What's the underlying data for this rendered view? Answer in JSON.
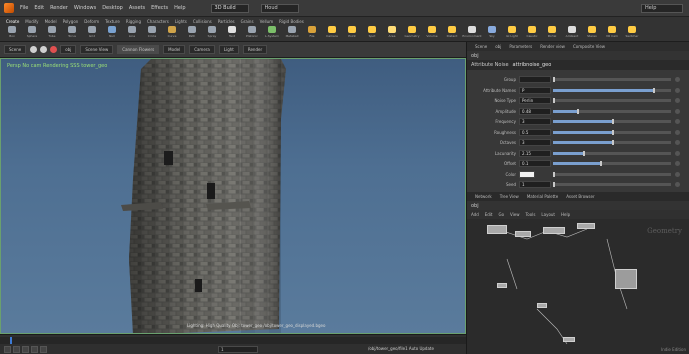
{
  "menubar": {
    "items": [
      "File",
      "Edit",
      "Render",
      "Windows",
      "Desktop",
      "Assets",
      "Effects",
      "Help"
    ],
    "desktop": "3D Build",
    "desktop2": "Houd",
    "help_search": "Help"
  },
  "shelf": {
    "tabs": [
      "Create",
      "Modify",
      "Model",
      "Polygon",
      "Deform",
      "Texture",
      "Rigging",
      "Characters",
      "Lights",
      "Collisions",
      "Particles",
      "Grains",
      "Vellum",
      "Rigid Bodies"
    ],
    "tools": [
      {
        "label": "Box",
        "color": "#9aa4b0"
      },
      {
        "label": "Sphere",
        "color": "#9aa4b0"
      },
      {
        "label": "Tube",
        "color": "#9aa4b0"
      },
      {
        "label": "Torus",
        "color": "#9aa4b0"
      },
      {
        "label": "Grid",
        "color": "#9aa4b0"
      },
      {
        "label": "Null",
        "color": "#7aa2d0"
      },
      {
        "label": "Line",
        "color": "#9aa4b0"
      },
      {
        "label": "Circle",
        "color": "#9aa4b0"
      },
      {
        "label": "Curve",
        "color": "#d0a44a"
      },
      {
        "label": "Path",
        "color": "#9aa4b0"
      },
      {
        "label": "Spray",
        "color": "#9aa4b0"
      },
      {
        "label": "Text",
        "color": "#e0e0e0"
      },
      {
        "label": "Platonic",
        "color": "#9aa4b0"
      },
      {
        "label": "L-System",
        "color": "#7cbf6a"
      },
      {
        "label": "Metaball",
        "color": "#9aa4b0"
      },
      {
        "label": "File",
        "color": "#d9a23a"
      }
    ],
    "right_tools": [
      {
        "label": "Camera",
        "color": "#ffcc44"
      },
      {
        "label": "Point",
        "color": "#ffcc44"
      },
      {
        "label": "Spot",
        "color": "#ffcc44"
      },
      {
        "label": "Area",
        "color": "#ffdd77"
      },
      {
        "label": "Geometry",
        "color": "#ffcc44"
      },
      {
        "label": "Volume",
        "color": "#ffcc44"
      },
      {
        "label": "Distant",
        "color": "#ffcc44"
      },
      {
        "label": "Environment",
        "color": "#dddddd"
      },
      {
        "label": "Sky",
        "color": "#88aadd"
      },
      {
        "label": "GI Light",
        "color": "#ffcc44"
      },
      {
        "label": "Caustic",
        "color": "#ffcc44"
      },
      {
        "label": "Portal",
        "color": "#ffcc44"
      },
      {
        "label": "Ambient",
        "color": "#dddddd"
      },
      {
        "label": "Stereo",
        "color": "#ffcc44"
      },
      {
        "label": "VR Cam",
        "color": "#ffcc44"
      },
      {
        "label": "Switcher",
        "color": "#ffcc44"
      }
    ]
  },
  "toolbar2": {
    "items": [
      "Scene",
      "obj",
      "Scene View",
      "Model",
      "Camera",
      "Light",
      "Render View"
    ],
    "pane": "Cannon Flowers",
    "render": "Render"
  },
  "viewport": {
    "label_top": "Persp  No cam  Rendering SSS  tower_geo",
    "label_bottom": "Lighting: High Quality  Obj: tower_geo  /obj/tower_geo_displayed.bgeo"
  },
  "timeline": {
    "frame": "1",
    "path": "/obj/tower_geo/file1  Auto Update"
  },
  "param_pane": {
    "tabs": [
      "Scene",
      "obj",
      "Parameters",
      "Render view",
      "Composite View"
    ],
    "path": "obj",
    "node_type": "Attribute Noise",
    "node_name": "attribnoise_geo",
    "rows": [
      {
        "label": "Group",
        "value": "",
        "fill": 0
      },
      {
        "label": "Attribute Names",
        "value": "P",
        "fill": 0.85
      },
      {
        "label": "Noise Type",
        "value": "Perlin",
        "fill": 0
      },
      {
        "label": "Amplitude",
        "value": "0.48",
        "fill": 0.2
      },
      {
        "label": "Frequency",
        "value": "3",
        "fill": 0.5
      },
      {
        "label": "Roughness",
        "value": "0.5",
        "fill": 0.5
      },
      {
        "label": "Octaves",
        "value": "3",
        "fill": 0.5
      },
      {
        "label": "Lacunarity",
        "value": "2.15",
        "fill": 0.25
      },
      {
        "label": "Offset",
        "value": "0.1",
        "fill": 0.4
      },
      {
        "label": "Color",
        "value": "",
        "fill": 0
      },
      {
        "label": "Seed",
        "value": "1",
        "fill": 0
      }
    ]
  },
  "net_pane": {
    "tabs": [
      "Network",
      "Tree View",
      "Material Palette",
      "Asset Browser"
    ],
    "path": "obj",
    "tools": [
      "Add",
      "Edit",
      "Go",
      "View",
      "Tools",
      "Layout",
      "Help"
    ],
    "watermark": "Geometry",
    "status": "Indie Edition"
  }
}
